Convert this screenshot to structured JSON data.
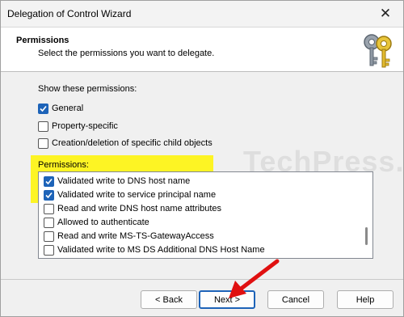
{
  "window": {
    "title": "Delegation of Control Wizard"
  },
  "header": {
    "title": "Permissions",
    "subtitle": "Select the permissions you want to delegate."
  },
  "show_permissions": {
    "label": "Show these permissions:",
    "options": [
      {
        "label": "General",
        "checked": true
      },
      {
        "label": "Property-specific",
        "checked": false
      },
      {
        "label": "Creation/deletion of specific child objects",
        "checked": false
      }
    ]
  },
  "permissions": {
    "label": "Permissions:",
    "items": [
      {
        "label": "Validated write to DNS host name",
        "checked": true
      },
      {
        "label": "Validated write to service principal name",
        "checked": true
      },
      {
        "label": "Read and write DNS host name attributes",
        "checked": false
      },
      {
        "label": "Allowed to authenticate",
        "checked": false
      },
      {
        "label": "Read and write MS-TS-GatewayAccess",
        "checked": false
      },
      {
        "label": "Validated write to MS DS Additional DNS Host Name",
        "checked": false
      }
    ]
  },
  "watermark": "TechPress.net",
  "buttons": {
    "back": "< Back",
    "next": "Next >",
    "cancel": "Cancel",
    "help": "Help"
  },
  "colors": {
    "accent": "#1d63b8",
    "highlight": "#fff500",
    "annotation_arrow": "#e01010"
  }
}
